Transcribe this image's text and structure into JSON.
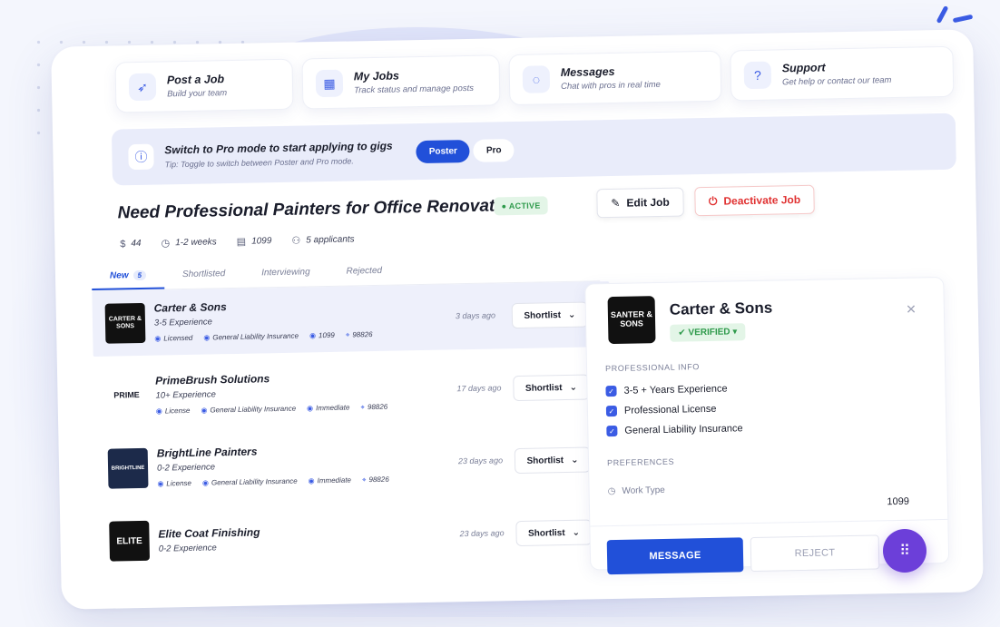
{
  "quick_actions": [
    {
      "icon": "rocket-icon",
      "glyph": "➶",
      "title": "Post a Job",
      "subtitle": "Build your team"
    },
    {
      "icon": "calendar-icon",
      "glyph": "▦",
      "title": "My Jobs",
      "subtitle": "Track status and manage posts"
    },
    {
      "icon": "chat-icon",
      "glyph": "◌",
      "title": "Messages",
      "subtitle": "Chat with pros in real time"
    },
    {
      "icon": "help-icon",
      "glyph": "?",
      "title": "Support",
      "subtitle": "Get help or contact our team"
    }
  ],
  "mode_switch": {
    "icon": "info-icon",
    "title": "Switch to Pro mode to start applying to gigs",
    "tip": "Tip: Toggle to switch between Poster and Pro mode.",
    "options": [
      "Poster",
      "Pro"
    ],
    "selected": "Poster"
  },
  "job": {
    "title": "Need Professional Painters for Office Renovation",
    "status": "ACTIVE",
    "edit_label": "Edit Job",
    "deactivate_label": "Deactivate Job",
    "meta": {
      "pay": "44",
      "duration": "1-2 weeks",
      "type": "1099",
      "applicants": "5 applicants"
    }
  },
  "tabs": [
    {
      "label": "New",
      "count": "5"
    },
    {
      "label": "Shortlisted"
    },
    {
      "label": "Interviewing"
    },
    {
      "label": "Rejected"
    }
  ],
  "applicants": [
    {
      "name": "Carter & Sons",
      "logo": "CARTER & SONS",
      "experience": "3-5 Experience",
      "tags": [
        "Licensed",
        "General Liability Insurance",
        "1099",
        "98826"
      ],
      "time": "3 days ago",
      "action": "Shortlist"
    },
    {
      "name": "PrimeBrush Solutions",
      "logo": "PRIME",
      "experience": "10+ Experience",
      "tags": [
        "License",
        "General Liability Insurance",
        "Immediate",
        "98826"
      ],
      "time": "17 days ago",
      "action": "Shortlist"
    },
    {
      "name": "BrightLine Painters",
      "logo": "BRIGHTLINE",
      "experience": "0-2 Experience",
      "tags": [
        "License",
        "General Liability Insurance",
        "Immediate",
        "98826"
      ],
      "time": "23 days ago",
      "action": "Shortlist"
    },
    {
      "name": "Elite Coat Finishing",
      "logo": "ELITE",
      "experience": "0-2 Experience",
      "tags": [],
      "time": "23 days ago",
      "action": "Shortlist"
    }
  ],
  "detail": {
    "logo": "SANTER & SONS",
    "name": "Carter & Sons",
    "verified": "VERIFIED",
    "professional_info_heading": "PROFESSIONAL INFO",
    "professional_info": [
      "3-5 + Years Experience",
      "Professional License",
      "General Liability Insurance"
    ],
    "preferences_heading": "PREFERENCES",
    "work_type_label": "Work Type",
    "work_type_value": "1099",
    "message_label": "MESSAGE",
    "reject_label": "REJECT"
  },
  "colors": {
    "accent": "#2150d9",
    "active_green": "#2e9a4b",
    "danger": "#e03131",
    "fab": "#6c3fd9"
  }
}
